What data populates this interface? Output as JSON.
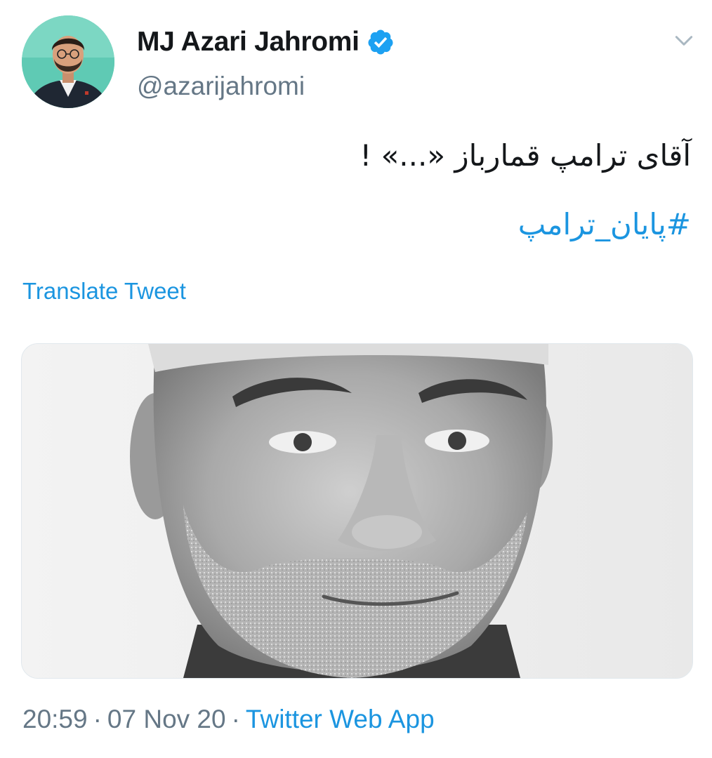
{
  "author": {
    "display_name": "MJ Azari Jahromi",
    "handle": "@azarijahromi",
    "verified": true,
    "avatar_icon": "profile-photo"
  },
  "header": {
    "menu_icon": "chevron-down-icon"
  },
  "tweet": {
    "text": "آقای ترامپ قمارباز «...» !",
    "hashtag": "#پایان_ترامپ",
    "translate_label": "Translate Tweet",
    "media_description_icon": "tweet-photo"
  },
  "meta": {
    "time": "20:59",
    "separator": "·",
    "date": "07 Nov 20",
    "source": "Twitter Web App"
  },
  "colors": {
    "link": "#1b95e0",
    "secondary_text": "#657786",
    "primary_text": "#14171a",
    "verified_badge": "#1da1f2"
  }
}
